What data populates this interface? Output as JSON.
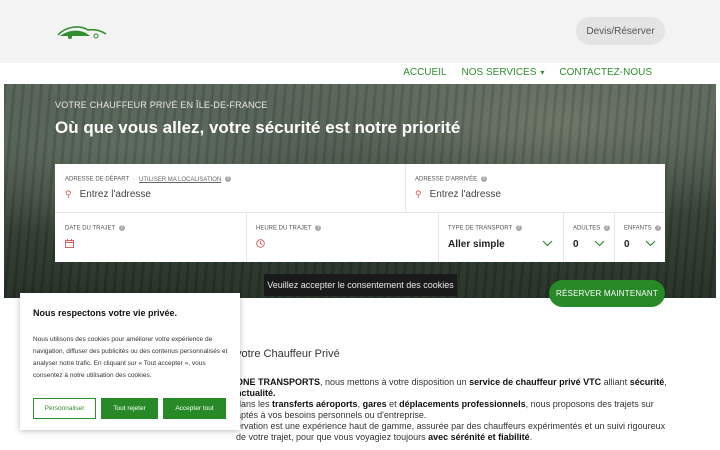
{
  "header": {
    "quote_button": "Devis/Réserver"
  },
  "nav": {
    "items": [
      {
        "label": "ACCUEIL"
      },
      {
        "label": "NOS SERVICES"
      },
      {
        "label": "CONTACTEZ-NOUS"
      }
    ]
  },
  "hero": {
    "kicker": "VOTRE CHAUFFEUR PRIVÉ EN ÎLE-DE-FRANCE",
    "title": "Où que vous allez, votre sécurité est notre priorité"
  },
  "form": {
    "departure": {
      "label": "ADRESSE DE DÉPART",
      "link": "UTILISER MA LOCALISATION",
      "placeholder": "Entrez l'adresse"
    },
    "arrival": {
      "label": "ADRESSE D'ARRIVÉE",
      "placeholder": "Entrez l'adresse"
    },
    "date": {
      "label": "DATE DU TRAJET"
    },
    "time": {
      "label": "HEURE DU TRAJET"
    },
    "transport_type": {
      "label": "TYPE DE TRANSPORT",
      "value": "Aller simple"
    },
    "adults": {
      "label": "ADULTES",
      "value": "0"
    },
    "children": {
      "label": "ENFANTS",
      "value": "0"
    }
  },
  "cookie_notice": "Veuillez accepter le consentement des cookies",
  "reserve_button": "RÉSERVER MAINTENANT",
  "content": {
    "heading": "votre Chauffeur Privé",
    "p1": {
      "a": " ONE TRANSPORTS",
      "b": ", nous mettons à votre disposition un ",
      "c": "service de chauffeur privé VTC",
      "d": " alliant ",
      "e": "sécurité",
      "f": ","
    },
    "p1b": "nctualité.",
    "p2": {
      "a": "dans les ",
      "b": "transferts aéroports",
      "c": ", ",
      "d": "gares",
      "e": " et ",
      "f": "déplacements professionnels",
      "g": ", nous proposons des trajets sur"
    },
    "p2b": "aptés à vos besoins personnels ou d'entreprise.",
    "p3": "ervation est une expérience haut de gamme, assurée par des chauffeurs expérimentés et un suivi rigoureux",
    "p4": {
      "a": "de votre trajet, pour que vous voyagiez toujours ",
      "b": "avec sérénité et fiabilité",
      "c": "."
    }
  },
  "cookie_panel": {
    "title": "Nous respectons votre vie privée.",
    "text": "Nous utilisons des cookies pour améliorer votre expérience de navigation, diffuser des publicités ou des contenus personnalisés et analyser notre trafic. En cliquant sur « Tout accepter », vous consentez à notre utilisation des cookies.",
    "customize": "Personnaliser",
    "reject": "Tout rejeter",
    "accept": "Accepter tout"
  },
  "colors": {
    "brand_green": "#278a27",
    "nav_green": "#2f8f2f",
    "pin_red": "#d9534f"
  },
  "icons": [
    "car-logo-icon",
    "map-pin-icon",
    "calendar-icon",
    "clock-icon",
    "chevron-down-icon",
    "help-icon"
  ]
}
